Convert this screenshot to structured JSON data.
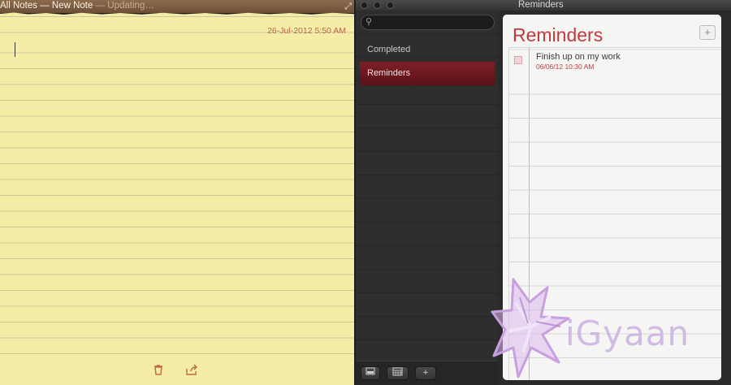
{
  "notes": {
    "title_main": "All Notes — New Note",
    "title_status": "— Updating…",
    "date": "26-Jul-2012 5:50 AM",
    "delete_icon": "trash-icon",
    "share_icon": "share-icon"
  },
  "reminders": {
    "window_title": "Reminders",
    "search_placeholder": "",
    "sidebar": {
      "items": [
        {
          "label": "Completed",
          "active": false
        },
        {
          "label": "Reminders",
          "active": true
        }
      ]
    },
    "bottom_buttons": {
      "show_calendar_icon": "calendar-icon",
      "add_label": "+"
    },
    "list": {
      "title": "Reminders",
      "add_label": "+",
      "items": [
        {
          "title": "Finish up on my work",
          "due": "06/06/12 10:30 AM"
        }
      ]
    }
  },
  "watermark": {
    "text": "iGyaan"
  },
  "colors": {
    "note_paper": "#f5eca6",
    "accent_red": "#c23a3d",
    "sidebar_active": "#7e1f28"
  }
}
